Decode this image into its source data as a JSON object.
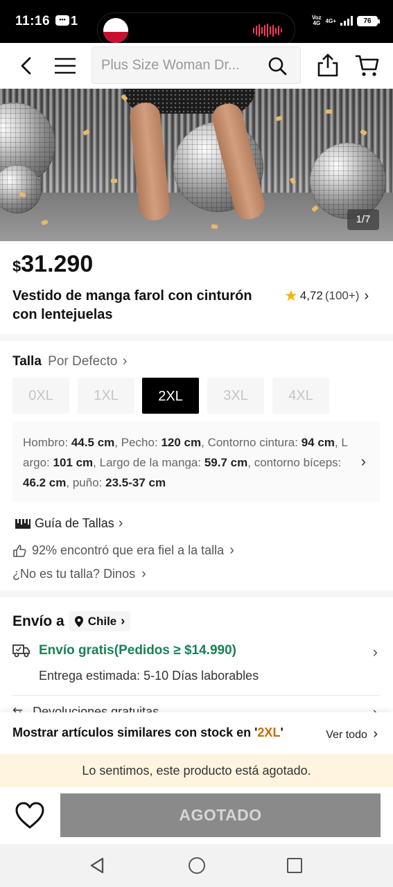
{
  "status": {
    "time": "11:16",
    "chat_icon": "chat-bubble-icon",
    "notification_count": "1",
    "net_top": "Voz",
    "net_bottom": "4G",
    "signal_label": "4G+",
    "battery": "76"
  },
  "nav": {
    "search_placeholder": "Plus Size Woman Dr...",
    "icons": [
      "back-icon",
      "menu-icon",
      "search-icon",
      "share-icon",
      "cart-icon"
    ]
  },
  "gallery": {
    "counter": "1/7"
  },
  "product": {
    "currency": "$",
    "price": "31.290",
    "title": "Vestido de manga farol con cinturón con lentejuelas",
    "rating": "4,72",
    "rating_count": "(100+)"
  },
  "size": {
    "label": "Talla",
    "default_label": "Por Defecto",
    "options": [
      "0XL",
      "1XL",
      "2XL",
      "3XL",
      "4XL"
    ],
    "selected": "2XL",
    "measurements": [
      {
        "label": "Hombro:",
        "value": "44.5 cm"
      },
      {
        "label": "Pecho:",
        "value": "120 cm"
      },
      {
        "label": "Contorno cintura:",
        "value": "94 cm"
      },
      {
        "label": "Largo:",
        "value": "101 cm"
      },
      {
        "label": "Largo de la manga:",
        "value": "59.7 cm"
      },
      {
        "label": "contorno bíceps:",
        "value": "46.2 cm"
      },
      {
        "label": "puño:",
        "value": "23.5-37 cm"
      }
    ],
    "guide_label": "Guía de Tallas",
    "fit_text": "92% encontró que era fiel a la talla",
    "not_your_size": "¿No es tu talla? Dinos"
  },
  "shipping": {
    "label": "Envío a",
    "country": "Chile",
    "free_shipping": "Envío gratis(Pedidos ≥ $14.990)",
    "delivery": "Entrega estimada: 5-10 Días laborables",
    "returns": "Devoluciones gratuitas"
  },
  "similar": {
    "text_prefix": "Mostrar artículos similares con stock en '",
    "size": "2XL",
    "text_suffix": "'",
    "see_all": "Ver todo"
  },
  "soldout_message": "Lo sentimos, este producto está agotado.",
  "cta": {
    "label": "AGOTADO"
  },
  "colors": {
    "free_shipping_green": "#198055",
    "selected_size_bg": "#000000",
    "highlight_size": "#c66a00",
    "banner_bg": "#fff4df",
    "cta_bg": "#8a8a8a",
    "star": "#f8b400"
  }
}
